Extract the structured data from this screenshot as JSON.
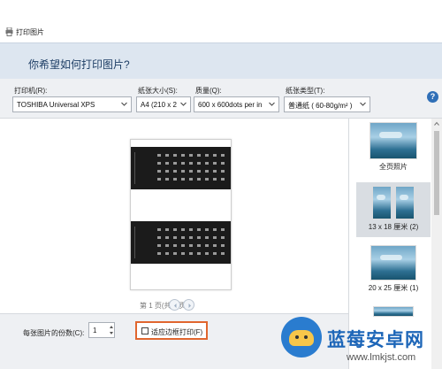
{
  "window": {
    "title": "打印图片"
  },
  "header": {
    "question": "你希望如何打印图片?"
  },
  "toolbar": {
    "printer": {
      "label": "打印机(R):",
      "value": "TOSHIBA Universal XPS"
    },
    "paper_size": {
      "label": "纸张大小(S):",
      "value": "A4 (210 x 2"
    },
    "quality": {
      "label": "质量(Q):",
      "value": "600 x 600dots per in"
    },
    "paper_type": {
      "label": "纸张类型(T):",
      "value": "普通纸 ( 60-80g/m² )"
    },
    "help_icon": "help-icon"
  },
  "preview": {
    "page_indicator": "第 1 页(共 1 页)"
  },
  "layouts": [
    {
      "label": "全页照片"
    },
    {
      "label": "13 x 18 厘米 (2)",
      "selected": true
    },
    {
      "label": "20 x 25 厘米 (1)"
    }
  ],
  "bottom": {
    "copies_label": "每张图片的份数(C):",
    "copies_value": "1",
    "fit_label": "适应边框打印(F)",
    "fit_checked": false
  },
  "watermark": {
    "title": "蓝莓安卓网",
    "url": "www.lmkjst.com"
  },
  "colors": {
    "accent": "#e0662f",
    "header_bg": "#dde6f0",
    "brand": "#1d66b8"
  }
}
